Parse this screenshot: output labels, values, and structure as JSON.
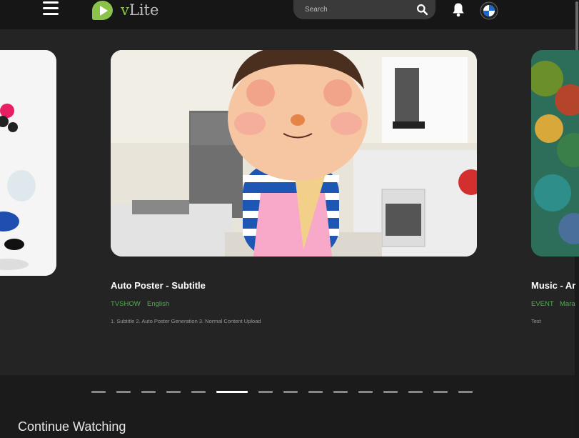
{
  "header": {
    "logo_letter": "v",
    "logo_rest": "Lite",
    "search_placeholder": "Search"
  },
  "slides": [
    {
      "title": "Auto Poster - Subtitle",
      "type": "TVSHOW",
      "language": "English",
      "description": "1. Subtitle 2. Auto Poster Generation 3. Normal Content Upload"
    },
    {
      "title": "Music - Ar",
      "type": "EVENT",
      "language": "Mara",
      "description": "Test"
    }
  ],
  "carousel": {
    "dot_count": 15,
    "active_index": 5
  },
  "continue_watching": {
    "title": "Continue Watching"
  },
  "colors": {
    "accent": "#8bc34a",
    "tag": "#4caf50",
    "header_bg": "#161616"
  }
}
